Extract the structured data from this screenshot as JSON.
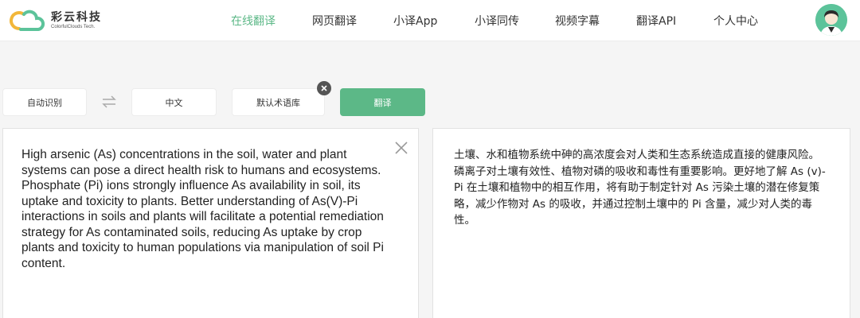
{
  "brand": {
    "name": "彩云科技",
    "sub": "ColorfulClouds Tech.",
    "accent": "#5cb887"
  },
  "nav": {
    "items": [
      {
        "label": "在线翻译",
        "active": true
      },
      {
        "label": "网页翻译"
      },
      {
        "label": "小译App"
      },
      {
        "label": "小译同传"
      },
      {
        "label": "视频字幕"
      },
      {
        "label": "翻译API"
      },
      {
        "label": "个人中心"
      }
    ]
  },
  "controls": {
    "source_lang": "自动识别",
    "target_lang": "中文",
    "glossary": "默认术语库",
    "translate_label": "翻译"
  },
  "source": {
    "text": "High arsenic (As) concentrations in the soil, water and plant systems can pose a direct health risk to humans and ecosystems. Phosphate (Pi) ions strongly influence As availability in soil, its uptake and toxicity to plants. Better understanding of As(V)-Pi interactions in soils and plants will facilitate a potential remediation strategy for As contaminated soils, reducing As uptake by crop plants and toxicity to human populations via manipulation of soil Pi content."
  },
  "result": {
    "text": "土壤、水和植物系统中砷的高浓度会对人类和生态系统造成直接的健康风险。磷离子对土壤有效性、植物对磷的吸收和毒性有重要影响。更好地了解 As (v)-Pi 在土壤和植物中的相互作用，将有助于制定针对 As 污染土壤的潜在修复策略，减少作物对 As 的吸收，并通过控制土壤中的 Pi 含量，减少对人类的毒性。"
  }
}
